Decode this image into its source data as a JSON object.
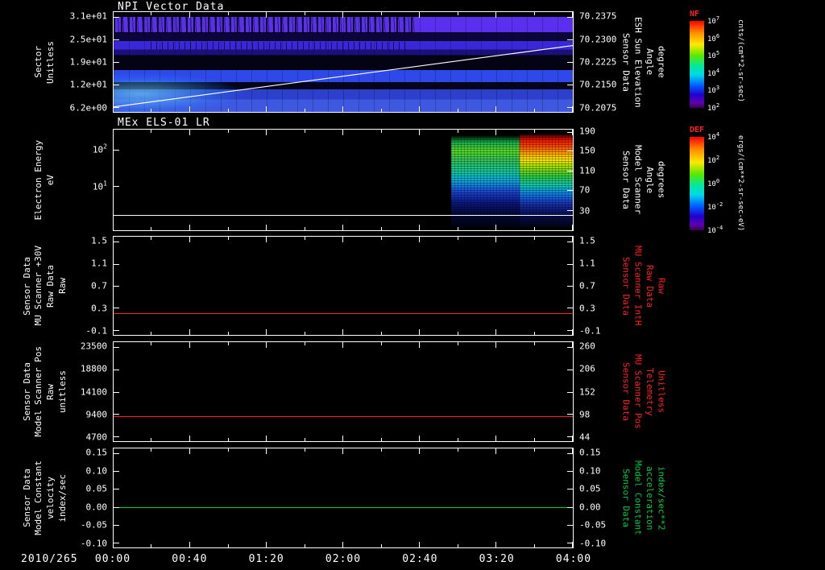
{
  "x_axis": {
    "date_label": "2010/265",
    "ticks": [
      "00:00",
      "00:40",
      "01:20",
      "02:00",
      "02:40",
      "03:20",
      "04:00"
    ]
  },
  "panels": [
    {
      "id": "npi",
      "title": "NPI Vector Data",
      "left_label": [
        "Sector",
        "Unitless"
      ],
      "left_ticks": [
        "3.1e+01",
        "2.5e+01",
        "1.9e+01",
        "1.2e+01",
        "6.2e+00"
      ],
      "right_ticks": [
        "70.2375",
        "70.2300",
        "70.2225",
        "70.2150",
        "70.2075"
      ],
      "right_label": [
        "Sensor Data",
        "ESH Sun Elevation",
        "Angle",
        "degree"
      ],
      "axis_top": 70.2375,
      "axis_bottom": 70.2075,
      "overlay_line": {
        "color": "#ffffff",
        "start_value": 70.2075,
        "end_value": 70.228
      },
      "bands": [
        {
          "from": 0.0,
          "to": 0.05,
          "color": "#000005"
        },
        {
          "from": 0.05,
          "to": 0.2,
          "color": "#5a30ee"
        },
        {
          "from": 0.2,
          "to": 0.29,
          "color": "#0b0538"
        },
        {
          "from": 0.29,
          "to": 0.375,
          "color": "#3a28d8"
        },
        {
          "from": 0.375,
          "to": 0.43,
          "color": "#1a1078"
        },
        {
          "from": 0.43,
          "to": 0.58,
          "color": "#040313"
        },
        {
          "from": 0.58,
          "to": 0.7,
          "color": "#2f48e8"
        },
        {
          "from": 0.7,
          "to": 0.775,
          "color": "#04041a"
        },
        {
          "from": 0.775,
          "to": 0.875,
          "color": "#2c40cc"
        },
        {
          "from": 0.875,
          "to": 1.0,
          "color": "#3e58e0"
        }
      ]
    },
    {
      "id": "els",
      "title": "MEx ELS-01 LR",
      "left_label": [
        "Electron Energy",
        "eV"
      ],
      "left_ticks": [
        "10^2",
        "10^1"
      ],
      "left_tick_pos": [
        0.2,
        0.56
      ],
      "left_tick_values": [
        100,
        10
      ],
      "scale": "log",
      "right_ticks": [
        "190",
        "150",
        "110",
        "70",
        "30"
      ],
      "right_tick_pos": [
        0.02,
        0.21,
        0.41,
        0.6,
        0.8
      ],
      "right_label": [
        "Sensor Data",
        "Model Scanner",
        "Angle",
        "degrees"
      ],
      "line": {
        "value": 1.6,
        "color": "#ffffff"
      },
      "blocks": [
        {
          "x0": 0.735,
          "x1": 0.885,
          "y0": 0.06,
          "y1": 0.97,
          "stops": [
            "#001802 0%",
            "#17b050 7%",
            "#55d828 16%",
            "#2fc060 28%",
            "#14c8a0 40%",
            "#10a0e0 50%",
            "#1b40d0 62%",
            "#0a1580 74%",
            "#040838 86%",
            "#010214 100%"
          ]
        },
        {
          "x0": 0.885,
          "x1": 1.0,
          "y0": 0.05,
          "y1": 0.97,
          "stops": [
            "#400000 0%",
            "#e81600 6%",
            "#ff4800 13%",
            "#ffa000 20%",
            "#ffe400 27%",
            "#a0e000 35%",
            "#30c840 45%",
            "#10c8b0 55%",
            "#1078e8 65%",
            "#1830b0 75%",
            "#081058 86%",
            "#020418 100%"
          ]
        }
      ]
    },
    {
      "id": "mu30v",
      "left_label": [
        "Sensor Data",
        "MU Scanner +30V",
        "Raw Data",
        "Raw"
      ],
      "left_ticks": [
        "1.5",
        "1.1",
        "0.7",
        "0.3",
        "-0.1"
      ],
      "right_ticks": [
        "1.5",
        "1.1",
        "0.7",
        "0.3",
        "-0.1"
      ],
      "right_label": [
        "Sensor Data",
        "MU Scanner IntH",
        "Raw Data",
        "Raw"
      ],
      "right_label_color": "#ff2222",
      "axis_top": 1.5,
      "axis_bottom": -0.1,
      "line": {
        "value": 0.2,
        "color": "#ff2222"
      }
    },
    {
      "id": "scanpos",
      "left_label": [
        "Sensor Data",
        "Model Scanner Pos",
        "Raw",
        "unitless"
      ],
      "left_ticks": [
        "23500",
        "18800",
        "14100",
        "9400",
        "4700"
      ],
      "right_ticks": [
        "260",
        "206",
        "152",
        "98",
        "44"
      ],
      "right_label": [
        "Sensor Data",
        "MU Scanner Pos",
        "Telemetry",
        "Unitless"
      ],
      "right_label_color": "#ff2222",
      "axis_top": 23500,
      "axis_bottom": 4700,
      "line": {
        "value": 8900,
        "color": "#ff2222"
      }
    },
    {
      "id": "velocity",
      "left_label": [
        "Sensor Data",
        "Model Constant",
        "velocity",
        "index/sec"
      ],
      "left_ticks": [
        "0.15",
        "0.10",
        "0.05",
        "0.00",
        "-0.05",
        "-0.10"
      ],
      "right_ticks": [
        "0.15",
        "0.10",
        "0.05",
        "0.00",
        "-0.05",
        "-0.10"
      ],
      "right_label": [
        "Sensor Data",
        "Model Constant",
        "acceleration",
        "index/sec**2"
      ],
      "right_label_color": "#00cc44",
      "axis_top": 0.15,
      "axis_bottom": -0.1,
      "line": {
        "value": 0.0,
        "color": "#00cc44"
      }
    }
  ],
  "colorbars": [
    {
      "id": "nf",
      "title": "NF",
      "ticks": [
        "10^7",
        "10^6",
        "10^5",
        "10^4",
        "10^3",
        "10^2"
      ],
      "unit": "cnts/(cm**2-sr-sec)"
    },
    {
      "id": "def",
      "title": "DEF",
      "ticks": [
        "10^4",
        "10^2",
        "10^0",
        "10^-2",
        "10^-4"
      ],
      "unit": "ergs/(cm**2-sr-sec-eV)"
    }
  ],
  "chart_data": [
    {
      "type": "heatmap",
      "title": "NPI Vector Data",
      "xlabel": "Time (2010/265 00:00 - 04:00)",
      "ylabel": "Sector Unitless",
      "y_ticks": [
        "3.1e+01",
        "2.5e+01",
        "1.9e+01",
        "1.2e+01",
        "6.2e+00"
      ],
      "colorbar": "NF cnts/(cm**2-sr-sec)",
      "color_scale_log10_range": [
        2,
        7
      ],
      "content": "Persistent horizontal blue/violet count bands at sectors ~5-9, ~12-14, ~19-21 and ~25-30 across all times; black elsewhere; scattered black dropouts in the upper band; bright cyan patch at lower left",
      "overlay_line": {
        "name": "Sensor Data ESH Sun Elevation Angle (degree)",
        "axis_range": [
          70.2075,
          70.2375
        ],
        "start_value": 70.2075,
        "end_value": 70.228
      }
    },
    {
      "type": "heatmap",
      "title": "MEx ELS-01 LR",
      "ylabel": "Electron Energy (eV)",
      "yscale": "log",
      "y_ticks": [
        "10^2",
        "10^1"
      ],
      "right_axis": {
        "name": "Sensor Data Model Scanner Angle (degrees)",
        "ticks": [
          190,
          150,
          110,
          70,
          30
        ]
      },
      "colorbar": "DEF ergs/(cm**2-sr-sec-eV)",
      "content": "Black (no data) from 00:00 to ~02:55; electron spectrogram from ~02:55 to 04:00; green-cyan mid energies first, intense red flux above ~50 eV after ~03:25, blue and speckled flux at lowest energies",
      "white_line_energy_ev": 1.6
    },
    {
      "type": "line",
      "ylabel": "Sensor Data MU Scanner +30V Raw Data Raw",
      "ylim": [
        -0.1,
        1.5
      ],
      "series": [
        {
          "name": "MU Scanner +30V Raw / MU Scanner IntH Raw",
          "color": "#ff2222",
          "constant_value": 0.2
        }
      ]
    },
    {
      "type": "line",
      "ylabel": "Sensor Data Model Scanner Pos Raw unitless",
      "ylim": [
        4700,
        23500
      ],
      "right_ylim": [
        44,
        260
      ],
      "series": [
        {
          "name": "Model Scanner Pos Raw / MU Scanner Pos Telemetry",
          "color": "#ff2222",
          "constant_value": 8900
        }
      ]
    },
    {
      "type": "line",
      "ylabel": "Sensor Data Model Constant velocity index/sec",
      "ylim": [
        -0.1,
        0.15
      ],
      "series": [
        {
          "name": "Model Constant velocity / acceleration",
          "color": "#00cc44",
          "constant_value": 0.0
        }
      ]
    }
  ]
}
